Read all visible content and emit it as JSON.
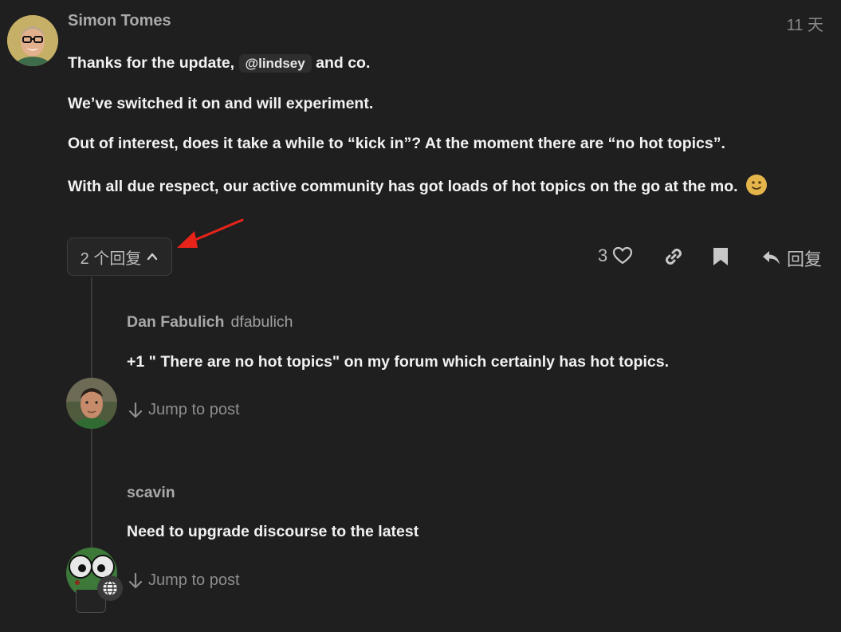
{
  "post": {
    "author": "Simon Tomes",
    "time": "11 天",
    "p1_before": "Thanks for the update,",
    "mention": "@lindsey",
    "p1_after": "and co.",
    "p2": "We’ve switched it on and will experiment.",
    "p3": "Out of interest, does it take a while to “kick in”? At the moment there are “no hot topics”.",
    "p4": "With all due respect, our active community has got loads of hot topics on the go at the mo."
  },
  "controls": {
    "replies_label": "2 个回复",
    "likes_count": "3",
    "reply_label": "回复"
  },
  "replies": [
    {
      "name": "Dan Fabulich",
      "username": "dfabulich",
      "text": "+1 \" There are no hot topics\" on my forum which certainly has hot topics.",
      "jump": "Jump to post"
    },
    {
      "name": "scavin",
      "username": "",
      "text": "Need to upgrade discourse to the latest",
      "jump": "Jump to post"
    }
  ],
  "colors": {
    "background": "#1f1f1f",
    "annotation_arrow": "#e8231a",
    "emoji": "#e5b54c"
  },
  "icons": [
    "heart-icon",
    "link-icon",
    "bookmark-icon",
    "reply-icon",
    "chevron-up-icon",
    "arrow-down-icon",
    "globe-icon"
  ]
}
